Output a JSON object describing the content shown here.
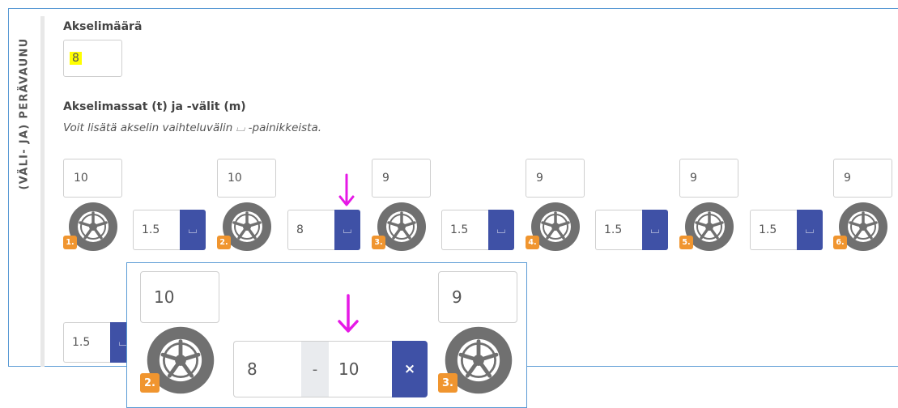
{
  "section_label": "(VÄLI- JA) PERÄVAUNU",
  "axle_count": {
    "label": "Akselimäärä",
    "value": "8"
  },
  "axle_masses": {
    "label": "Akselimassat (t) ja -välit (m)",
    "hint": "Voit lisätä akselin vaihteluvälin ⌴ -painikkeista."
  },
  "axles": [
    {
      "mass": "10",
      "number": "1."
    },
    {
      "mass": "10",
      "number": "2."
    },
    {
      "mass": "9",
      "number": "3."
    },
    {
      "mass": "9",
      "number": "4."
    },
    {
      "mass": "9",
      "number": "5."
    },
    {
      "mass": "9",
      "number": "6."
    }
  ],
  "gaps": [
    "1.5",
    "8",
    "1.5",
    "1.5",
    "1.5"
  ],
  "second_row_gap": "1.5",
  "range_button_symbol": "⌴",
  "zoom": {
    "axle_left": {
      "mass": "10",
      "number": "2."
    },
    "axle_right": {
      "mass": "9",
      "number": "3."
    },
    "range_from": "8",
    "range_separator": "-",
    "range_to": "10",
    "remove_symbol": "×"
  },
  "colors": {
    "accent": "#3f51a6",
    "badge": "#f0952f",
    "highlight": "#ffff00",
    "arrow": "#e619e6",
    "frame": "#5b9bd5"
  }
}
